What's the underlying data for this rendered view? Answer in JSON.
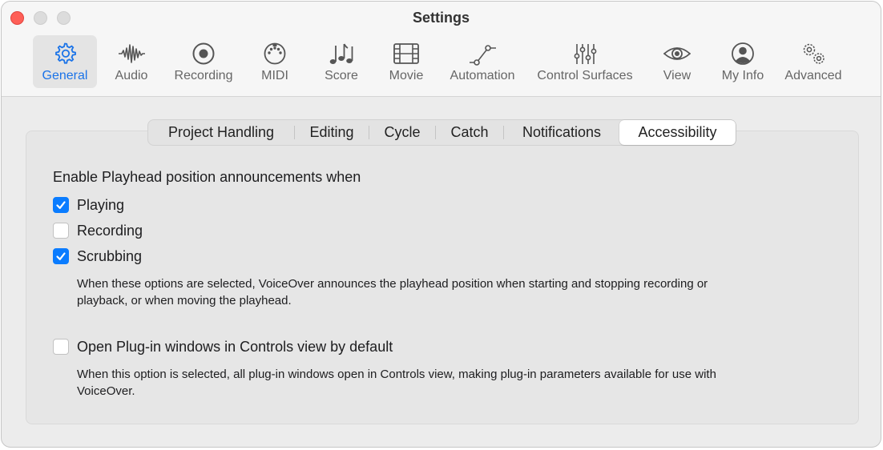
{
  "window": {
    "title": "Settings"
  },
  "toolbar": {
    "items": [
      {
        "label": "General",
        "icon": "gear-icon",
        "active": true
      },
      {
        "label": "Audio",
        "icon": "waveform-icon"
      },
      {
        "label": "Recording",
        "icon": "record-icon"
      },
      {
        "label": "MIDI",
        "icon": "midi-connector-icon"
      },
      {
        "label": "Score",
        "icon": "music-notes-icon"
      },
      {
        "label": "Movie",
        "icon": "film-icon"
      },
      {
        "label": "Automation",
        "icon": "automation-curve-icon"
      },
      {
        "label": "Control Surfaces",
        "icon": "sliders-icon"
      },
      {
        "label": "View",
        "icon": "eye-icon"
      },
      {
        "label": "My Info",
        "icon": "person-icon"
      },
      {
        "label": "Advanced",
        "icon": "gears-icon"
      }
    ]
  },
  "tabs": {
    "items": [
      "Project Handling",
      "Editing",
      "Cycle",
      "Catch",
      "Notifications",
      "Accessibility"
    ],
    "selected": "Accessibility"
  },
  "accessibility": {
    "heading": "Enable Playhead position announcements when",
    "options": [
      {
        "label": "Playing",
        "checked": true
      },
      {
        "label": "Recording",
        "checked": false
      },
      {
        "label": "Scrubbing",
        "checked": true
      }
    ],
    "playhead_help_line1": "When these options are selected, VoiceOver announces the playhead position when starting and stopping recording or",
    "playhead_help_line2": "playback, or when moving the playhead.",
    "plugin_option": {
      "label": "Open Plug-in windows in Controls view by default",
      "checked": false
    },
    "plugin_help_line1": "When this option is selected, all plug-in windows open in Controls view, making plug-in parameters available for use with",
    "plugin_help_line2": "VoiceOver."
  },
  "colors": {
    "accent": "#0a7cff",
    "active_label": "#1a73e8",
    "close_button": "#fe5f57"
  }
}
